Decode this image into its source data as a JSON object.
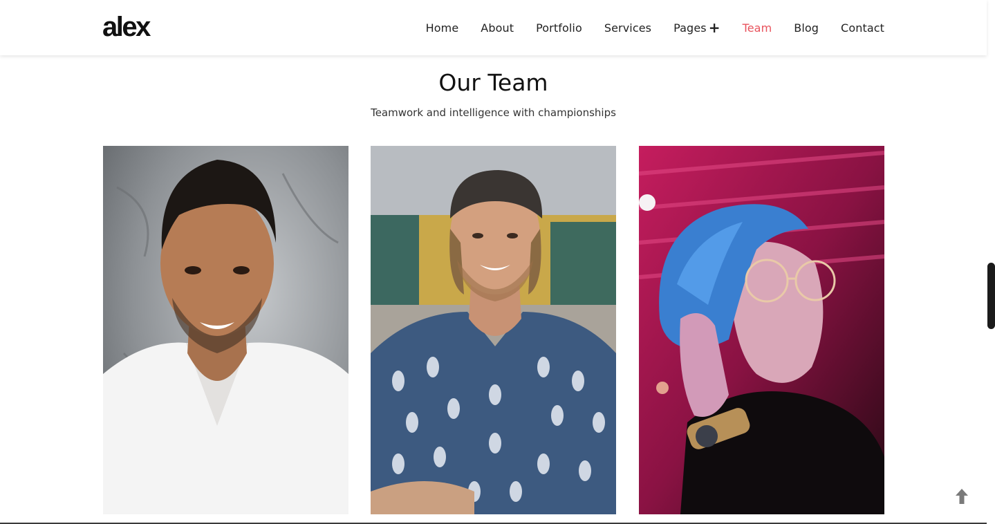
{
  "header": {
    "logo": "alex",
    "nav": [
      {
        "label": "Home"
      },
      {
        "label": "About"
      },
      {
        "label": "Portfolio"
      },
      {
        "label": "Services"
      },
      {
        "label": "Pages"
      },
      {
        "label": "Team"
      },
      {
        "label": "Blog"
      },
      {
        "label": "Contact"
      }
    ],
    "active_item": "Team",
    "dropdown_item": "Pages",
    "accent_color": "#e8525c"
  },
  "team_section": {
    "title": "Our Team",
    "subtitle": "Teamwork and intelligence with championships",
    "members": [
      {
        "photo_icon": "man-white-tshirt-photo"
      },
      {
        "photo_icon": "man-backwards-cap-photo"
      },
      {
        "photo_icon": "woman-blue-hair-photo"
      }
    ]
  },
  "controls": {
    "scroll_top_icon": "arrow-up-icon"
  }
}
